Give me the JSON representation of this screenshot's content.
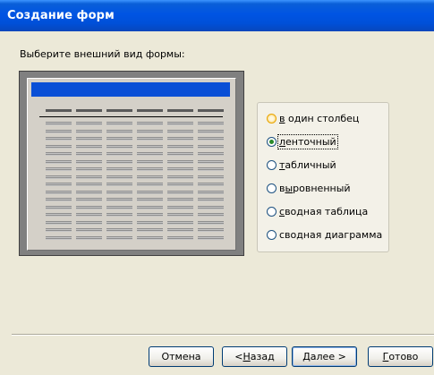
{
  "window": {
    "title": "Создание форм"
  },
  "prompt": "Выберите внешний вид формы:",
  "layout_options": [
    {
      "pre": "",
      "accel": "в",
      "post": " один столбец",
      "state": "hover"
    },
    {
      "pre": "",
      "accel": "л",
      "post": "енточный",
      "state": "checked"
    },
    {
      "pre": "",
      "accel": "т",
      "post": "абличный",
      "state": ""
    },
    {
      "pre": "в",
      "accel": "ы",
      "post": "ровненный",
      "state": ""
    },
    {
      "pre": "",
      "accel": "с",
      "post": "водная таблица",
      "state": ""
    },
    {
      "pre": "сводная ",
      "accel": "д",
      "post": "иаграмма",
      "state": ""
    }
  ],
  "buttons": {
    "cancel": "Отмена",
    "back": {
      "pre": "< ",
      "accel": "Н",
      "post": "азад"
    },
    "next": {
      "pre": "",
      "accel": "Д",
      "post": "алее >"
    },
    "finish": {
      "pre": "",
      "accel": "Г",
      "post": "отово"
    }
  },
  "colors": {
    "titlebar": "#0054e3",
    "preview_header": "#0a4fd6",
    "dialog_bg": "#ece9d8"
  }
}
